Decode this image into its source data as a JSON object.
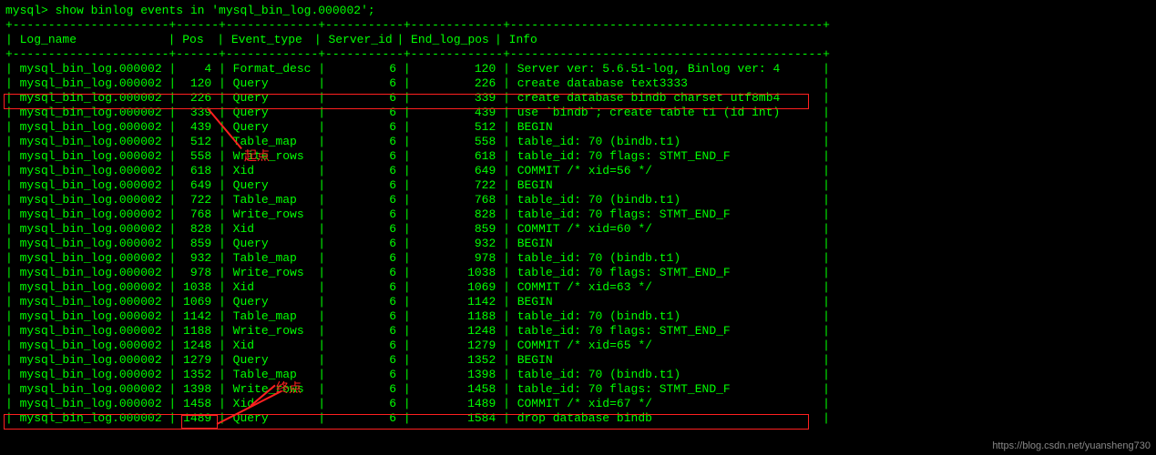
{
  "prompt": "mysql> show binlog events in 'mysql_bin_log.000002';",
  "divider": "+----------------------+------+-------------+-----------+-------------+--------------------------------------------+",
  "headers": {
    "log_name": "Log_name",
    "pos": "Pos",
    "event_type": "Event_type",
    "server_id": "Server_id",
    "end_log_pos": "End_log_pos",
    "info": "Info"
  },
  "rows": [
    {
      "log": "mysql_bin_log.000002",
      "pos": "4",
      "type": "Format_desc",
      "sid": "6",
      "end": "120",
      "info": "Server ver: 5.6.51-log, Binlog ver: 4"
    },
    {
      "log": "mysql_bin_log.000002",
      "pos": "120",
      "type": "Query",
      "sid": "6",
      "end": "226",
      "info": "create database text3333"
    },
    {
      "log": "mysql_bin_log.000002",
      "pos": "226",
      "type": "Query",
      "sid": "6",
      "end": "339",
      "info": "create database bindb charset utf8mb4"
    },
    {
      "log": "mysql_bin_log.000002",
      "pos": "339",
      "type": "Query",
      "sid": "6",
      "end": "439",
      "info": "use `bindb`; create table t1 (id int)"
    },
    {
      "log": "mysql_bin_log.000002",
      "pos": "439",
      "type": "Query",
      "sid": "6",
      "end": "512",
      "info": "BEGIN"
    },
    {
      "log": "mysql_bin_log.000002",
      "pos": "512",
      "type": "Table_map",
      "sid": "6",
      "end": "558",
      "info": "table_id: 70 (bindb.t1)"
    },
    {
      "log": "mysql_bin_log.000002",
      "pos": "558",
      "type": "Write_rows",
      "sid": "6",
      "end": "618",
      "info": "table_id: 70 flags: STMT_END_F"
    },
    {
      "log": "mysql_bin_log.000002",
      "pos": "618",
      "type": "Xid",
      "sid": "6",
      "end": "649",
      "info": "COMMIT /* xid=56 */"
    },
    {
      "log": "mysql_bin_log.000002",
      "pos": "649",
      "type": "Query",
      "sid": "6",
      "end": "722",
      "info": "BEGIN"
    },
    {
      "log": "mysql_bin_log.000002",
      "pos": "722",
      "type": "Table_map",
      "sid": "6",
      "end": "768",
      "info": "table_id: 70 (bindb.t1)"
    },
    {
      "log": "mysql_bin_log.000002",
      "pos": "768",
      "type": "Write_rows",
      "sid": "6",
      "end": "828",
      "info": "table_id: 70 flags: STMT_END_F"
    },
    {
      "log": "mysql_bin_log.000002",
      "pos": "828",
      "type": "Xid",
      "sid": "6",
      "end": "859",
      "info": "COMMIT /* xid=60 */"
    },
    {
      "log": "mysql_bin_log.000002",
      "pos": "859",
      "type": "Query",
      "sid": "6",
      "end": "932",
      "info": "BEGIN"
    },
    {
      "log": "mysql_bin_log.000002",
      "pos": "932",
      "type": "Table_map",
      "sid": "6",
      "end": "978",
      "info": "table_id: 70 (bindb.t1)"
    },
    {
      "log": "mysql_bin_log.000002",
      "pos": "978",
      "type": "Write_rows",
      "sid": "6",
      "end": "1038",
      "info": "table_id: 70 flags: STMT_END_F"
    },
    {
      "log": "mysql_bin_log.000002",
      "pos": "1038",
      "type": "Xid",
      "sid": "6",
      "end": "1069",
      "info": "COMMIT /* xid=63 */"
    },
    {
      "log": "mysql_bin_log.000002",
      "pos": "1069",
      "type": "Query",
      "sid": "6",
      "end": "1142",
      "info": "BEGIN"
    },
    {
      "log": "mysql_bin_log.000002",
      "pos": "1142",
      "type": "Table_map",
      "sid": "6",
      "end": "1188",
      "info": "table_id: 70 (bindb.t1)"
    },
    {
      "log": "mysql_bin_log.000002",
      "pos": "1188",
      "type": "Write_rows",
      "sid": "6",
      "end": "1248",
      "info": "table_id: 70 flags: STMT_END_F"
    },
    {
      "log": "mysql_bin_log.000002",
      "pos": "1248",
      "type": "Xid",
      "sid": "6",
      "end": "1279",
      "info": "COMMIT /* xid=65 */"
    },
    {
      "log": "mysql_bin_log.000002",
      "pos": "1279",
      "type": "Query",
      "sid": "6",
      "end": "1352",
      "info": "BEGIN"
    },
    {
      "log": "mysql_bin_log.000002",
      "pos": "1352",
      "type": "Table_map",
      "sid": "6",
      "end": "1398",
      "info": "table_id: 70 (bindb.t1)"
    },
    {
      "log": "mysql_bin_log.000002",
      "pos": "1398",
      "type": "Write_rows",
      "sid": "6",
      "end": "1458",
      "info": "table_id: 70 flags: STMT_END_F"
    },
    {
      "log": "mysql_bin_log.000002",
      "pos": "1458",
      "type": "Xid",
      "sid": "6",
      "end": "1489",
      "info": "COMMIT /* xid=67 */"
    },
    {
      "log": "mysql_bin_log.000002",
      "pos": "1489",
      "type": "Query",
      "sid": "6",
      "end": "1584",
      "info": "drop database bindb"
    }
  ],
  "annotations": {
    "start": "起点",
    "end": "终点"
  },
  "watermark": "https://blog.csdn.net/yuansheng730"
}
